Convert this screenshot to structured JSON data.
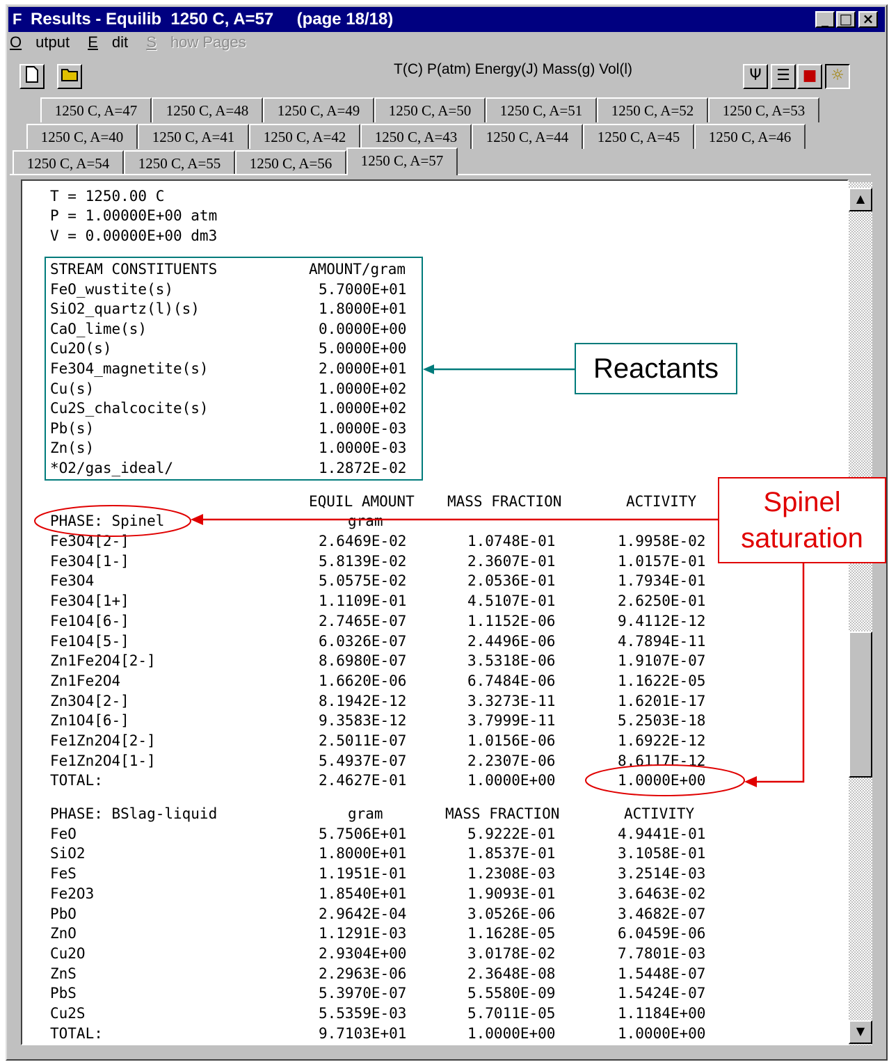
{
  "window": {
    "title": "Results - Equilib  1250 C, A=57     (page 18/18)",
    "app_icon": "F"
  },
  "menu": {
    "output": "Output",
    "edit": "Edit",
    "show_pages": "Show Pages"
  },
  "toolbar": {
    "units": "T(C) P(atm) Energy(J) Mass(g) Vol(l)"
  },
  "tabs": {
    "row1": [
      "1250 C, A=47",
      "1250 C, A=48",
      "1250 C, A=49",
      "1250 C, A=50",
      "1250 C, A=51",
      "1250 C, A=52",
      "1250 C, A=53"
    ],
    "row2": [
      "1250 C, A=40",
      "1250 C, A=41",
      "1250 C, A=42",
      "1250 C, A=43",
      "1250 C, A=44",
      "1250 C, A=45",
      "1250 C, A=46"
    ],
    "row3": [
      "1250 C, A=54",
      "1250 C, A=55",
      "1250 C, A=56",
      "1250 C, A=57"
    ],
    "active": "1250 C, A=57"
  },
  "conditions": {
    "t": "T = 1250.00 C",
    "p": "P = 1.00000E+00 atm",
    "v": "V = 0.00000E+00 dm3"
  },
  "stream": {
    "header_name": "STREAM CONSTITUENTS",
    "header_amount": "AMOUNT/gram",
    "rows": [
      [
        "FeO_wustite(s)",
        "5.7000E+01"
      ],
      [
        "SiO2_quartz(l)(s)",
        "1.8000E+01"
      ],
      [
        "CaO_lime(s)",
        "0.0000E+00"
      ],
      [
        "Cu2O(s)",
        "5.0000E+00"
      ],
      [
        "Fe3O4_magnetite(s)",
        "2.0000E+01"
      ],
      [
        "Cu(s)",
        "1.0000E+02"
      ],
      [
        "Cu2S_chalcocite(s)",
        "1.0000E+02"
      ],
      [
        "Pb(s)",
        "1.0000E-03"
      ],
      [
        "Zn(s)",
        "1.0000E-03"
      ],
      [
        "*O2/gas_ideal/",
        "1.2872E-02"
      ]
    ]
  },
  "spinel": {
    "col_headers": [
      "EQUIL AMOUNT",
      "MASS FRACTION",
      "ACTIVITY"
    ],
    "phase_label": "PHASE: Spinel",
    "unit": "gram",
    "rows": [
      [
        "Fe3O4[2-]",
        "2.6469E-02",
        "1.0748E-01",
        "1.9958E-02"
      ],
      [
        "Fe3O4[1-]",
        "5.8139E-02",
        "2.3607E-01",
        "1.0157E-01"
      ],
      [
        "Fe3O4",
        "5.0575E-02",
        "2.0536E-01",
        "1.7934E-01"
      ],
      [
        "Fe3O4[1+]",
        "1.1109E-01",
        "4.5107E-01",
        "2.6250E-01"
      ],
      [
        "Fe1O4[6-]",
        "2.7465E-07",
        "1.1152E-06",
        "9.4112E-12"
      ],
      [
        "Fe1O4[5-]",
        "6.0326E-07",
        "2.4496E-06",
        "4.7894E-11"
      ],
      [
        "Zn1Fe2O4[2-]",
        "8.6980E-07",
        "3.5318E-06",
        "1.9107E-07"
      ],
      [
        "Zn1Fe2O4",
        "1.6620E-06",
        "6.7484E-06",
        "1.1622E-05"
      ],
      [
        "Zn3O4[2-]",
        "8.1942E-12",
        "3.3273E-11",
        "1.6201E-17"
      ],
      [
        "Zn1O4[6-]",
        "9.3583E-12",
        "3.7999E-11",
        "5.2503E-18"
      ],
      [
        "Fe1Zn2O4[2-]",
        "2.5011E-07",
        "1.0156E-06",
        "1.6922E-12"
      ],
      [
        "Fe1Zn2O4[1-]",
        "5.4937E-07",
        "2.2307E-06",
        "8.6117E-12"
      ],
      [
        "TOTAL:",
        "2.4627E-01",
        "1.0000E+00",
        "1.0000E+00"
      ]
    ]
  },
  "slag": {
    "phase_label": "PHASE: BSlag-liquid",
    "col_headers": [
      "gram",
      "MASS FRACTION",
      "ACTIVITY"
    ],
    "rows": [
      [
        "FeO",
        "5.7506E+01",
        "5.9222E-01",
        "4.9441E-01"
      ],
      [
        "SiO2",
        "1.8000E+01",
        "1.8537E-01",
        "3.1058E-01"
      ],
      [
        "FeS",
        "1.1951E-01",
        "1.2308E-03",
        "3.2514E-03"
      ],
      [
        "Fe2O3",
        "1.8540E+01",
        "1.9093E-01",
        "3.6463E-02"
      ],
      [
        "PbO",
        "2.9642E-04",
        "3.0526E-06",
        "3.4682E-07"
      ],
      [
        "ZnO",
        "1.1291E-03",
        "1.1628E-05",
        "6.0459E-06"
      ],
      [
        "Cu2O",
        "2.9304E+00",
        "3.0178E-02",
        "7.7801E-03"
      ],
      [
        "ZnS",
        "2.2963E-06",
        "2.3648E-08",
        "1.5448E-07"
      ],
      [
        "PbS",
        "5.3970E-07",
        "5.5580E-09",
        "1.5424E-07"
      ],
      [
        "Cu2S",
        "5.5359E-03",
        "5.7011E-05",
        "1.1184E+00"
      ],
      [
        "TOTAL:",
        "9.7103E+01",
        "1.0000E+00",
        "1.0000E+00"
      ]
    ]
  },
  "callouts": {
    "reactants": "Reactants",
    "spinel_line1": "Spinel",
    "spinel_line2": "saturation"
  },
  "colors": {
    "teal": "#007b7b",
    "red": "#e00000",
    "title_bar": "#000080"
  }
}
